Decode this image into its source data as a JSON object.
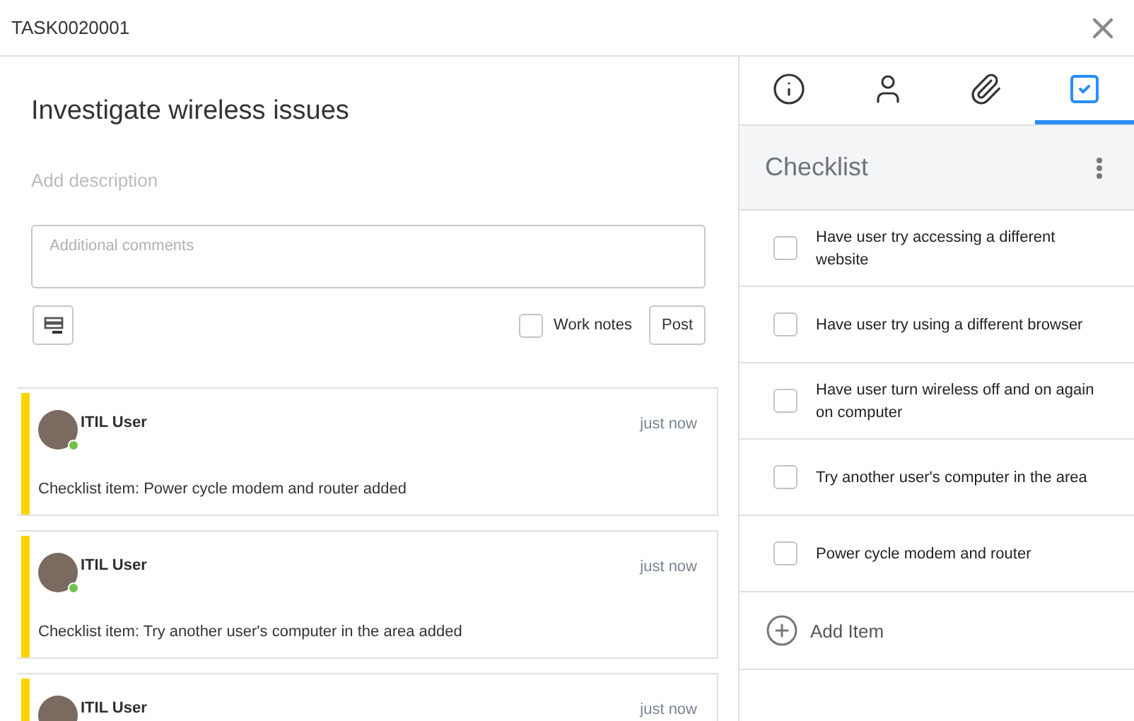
{
  "window": {
    "title": "TASK0020001"
  },
  "task": {
    "title": "Investigate wireless issues",
    "description_placeholder": "Add description"
  },
  "comment_box": {
    "placeholder": "Additional comments"
  },
  "work_notes": {
    "label": "Work notes",
    "checked": false
  },
  "post_button": "Post",
  "activity": [
    {
      "author": "ITIL User",
      "time": "just now",
      "text": "Checklist item: Power cycle modem and router added"
    },
    {
      "author": "ITIL User",
      "time": "just now",
      "text": "Checklist item: Try another user's computer in the area added"
    },
    {
      "author": "ITIL User",
      "time": "just now"
    }
  ],
  "tabs": [
    {
      "kind": "info",
      "selected": false
    },
    {
      "kind": "user",
      "selected": false
    },
    {
      "kind": "attachment",
      "selected": false
    },
    {
      "kind": "checklist",
      "selected": true
    }
  ],
  "checklist": {
    "title": "Checklist",
    "items": [
      {
        "label": "Have user try accessing a different website",
        "checked": false
      },
      {
        "label": "Have user try using a different browser",
        "checked": false
      },
      {
        "label": "Have user turn wireless off and on again on computer",
        "checked": false
      },
      {
        "label": "Try another user's computer in the area",
        "checked": false
      },
      {
        "label": "Power cycle modem and router",
        "checked": false
      }
    ],
    "add_label": "Add Item"
  }
}
